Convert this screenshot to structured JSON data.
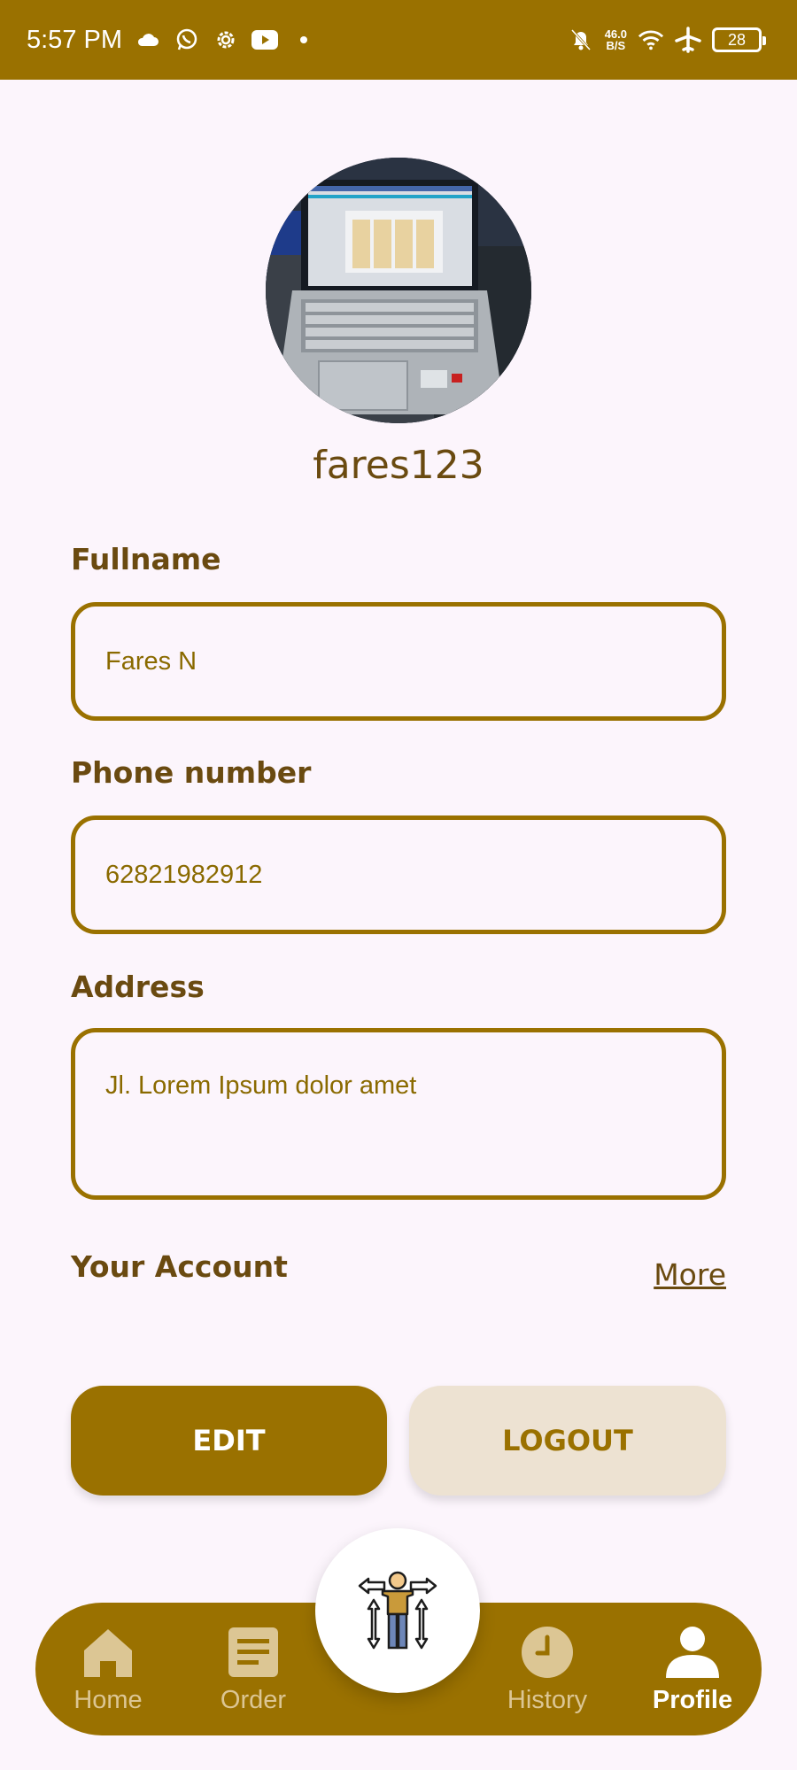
{
  "status_bar": {
    "time": "5:57 PM",
    "net_speed_value": "46.0",
    "net_speed_unit": "B/S",
    "battery": "28"
  },
  "profile": {
    "username": "fares123",
    "avatar_alt": "laptop photo"
  },
  "fields": {
    "fullname": {
      "label": "Fullname",
      "value": "Fares N"
    },
    "phone": {
      "label": "Phone number",
      "value": "62821982912"
    },
    "address": {
      "label": "Address",
      "value": "Jl. Lorem Ipsum dolor amet"
    }
  },
  "account": {
    "title": "Your Account",
    "more": "More"
  },
  "buttons": {
    "edit": "EDIT",
    "logout": "LOGOUT"
  },
  "nav": {
    "home": "Home",
    "order": "Order",
    "history": "History",
    "profile": "Profile"
  },
  "colors": {
    "primary": "#9a7100",
    "secondary_button": "#ede2d2",
    "text_dark": "#6a4a10",
    "background": "#fcf5fc"
  }
}
